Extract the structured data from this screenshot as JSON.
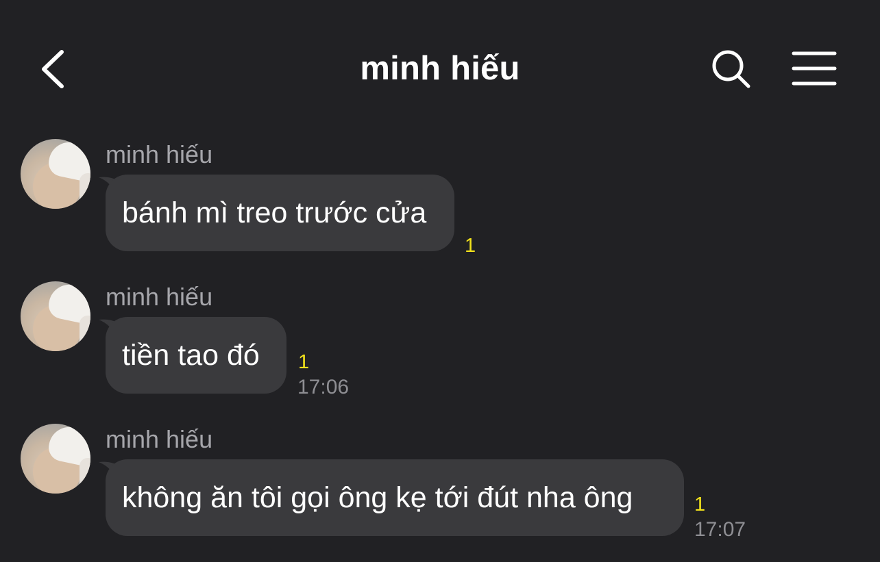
{
  "header": {
    "title": "minh hiếu",
    "back_icon": "chevron-left-icon",
    "search_icon": "search-icon",
    "menu_icon": "hamburger-menu-icon"
  },
  "messages": [
    {
      "sender": "minh hiếu",
      "text": "bánh mì treo trước cửa",
      "unread": "1",
      "time": ""
    },
    {
      "sender": "minh hiếu",
      "text": "tiền tao đó",
      "unread": "1",
      "time": "17:06"
    },
    {
      "sender": "minh hiếu",
      "text": "không ăn tôi gọi ông kẹ tới đút nha ông",
      "unread": "1",
      "time": "17:07"
    }
  ],
  "colors": {
    "background": "#212124",
    "bubble": "#3a3a3d",
    "unread": "#f2e21b",
    "time": "#8e8e93",
    "sender": "#a6a6ab"
  }
}
